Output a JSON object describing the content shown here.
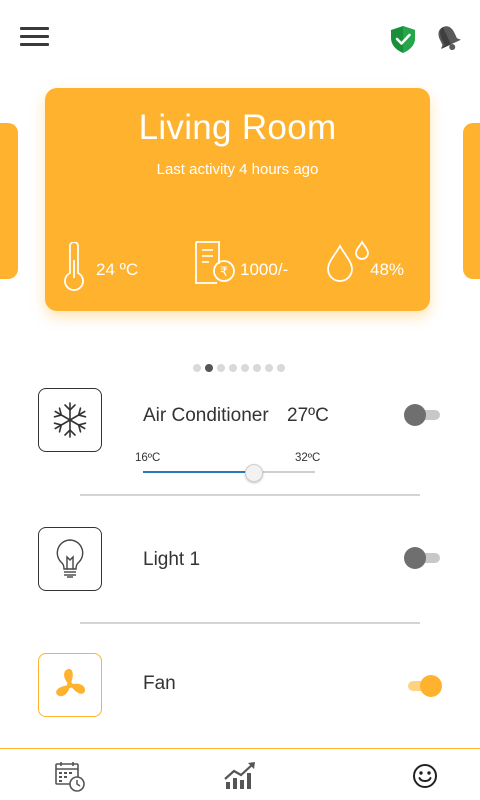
{
  "header": {
    "menu_icon": "hamburger-menu-icon",
    "shield_icon": "shield-check-icon",
    "bell_icon": "bell-icon",
    "accent": "#ffb22e"
  },
  "room": {
    "name": "Living Room",
    "last_activity": "Last activity 4 hours ago",
    "temperature": "24 ºC",
    "bill": "1000/-",
    "humidity": "48%"
  },
  "carousel": {
    "pages": 8,
    "active_index": 1
  },
  "devices": {
    "ac": {
      "name": "Air Conditioner",
      "temp": "27ºC",
      "min_label": "16ºC",
      "max_label": "32ºC",
      "min": 16,
      "max": 32,
      "value": 27,
      "on": false,
      "icon": "snowflake-icon"
    },
    "light": {
      "name": "Light 1",
      "on": false,
      "icon": "light-bulb-icon"
    },
    "fan": {
      "name": "Fan",
      "on": true,
      "icon": "fan-icon"
    }
  },
  "bottom_nav": [
    {
      "name": "schedule",
      "icon": "calendar-clock-icon"
    },
    {
      "name": "analytics",
      "icon": "chart-trend-icon"
    },
    {
      "name": "mood",
      "icon": "smiley-icon"
    }
  ]
}
